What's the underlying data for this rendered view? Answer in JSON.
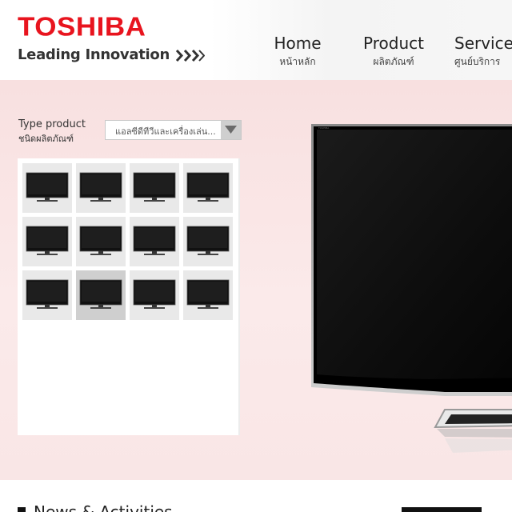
{
  "brand": {
    "wordmark": "TOSHIBA",
    "tagline": "Leading Innovation",
    "accent_color": "#e8141e"
  },
  "nav": {
    "items": [
      {
        "label": "Home",
        "sublabel": "หน้าหลัก"
      },
      {
        "label": "Product",
        "sublabel": "ผลิตภัณฑ์"
      },
      {
        "label": "Service",
        "sublabel": "ศูนย์บริการ"
      }
    ]
  },
  "filter": {
    "label": "Type product",
    "sublabel": "ชนิดผลิตภัณฑ์",
    "selected_value": "แอลซีดีทีวีและเครื่องเล่น...",
    "arrow_icon": "triangle-down-icon"
  },
  "products": {
    "thumbnail_icon": "tv-icon",
    "thumbnail_count": 12,
    "selected_index": 9
  },
  "news": {
    "title": "News & Activities"
  }
}
